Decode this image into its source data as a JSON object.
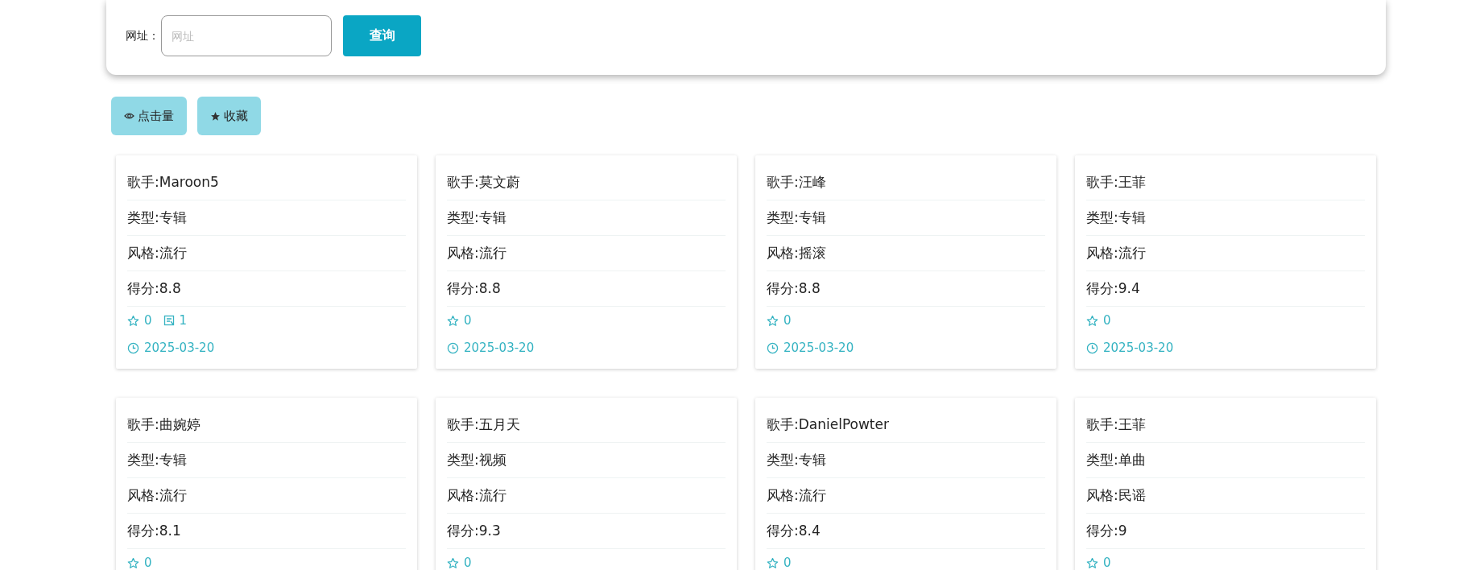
{
  "search": {
    "label": "网址：",
    "placeholder": "网址",
    "button": "查询"
  },
  "sort_buttons": [
    {
      "kind": "eye",
      "label": "点击量"
    },
    {
      "kind": "star",
      "label": "收藏"
    }
  ],
  "cards": [
    {
      "fields": [
        "歌手:Maroon5",
        "类型:专辑",
        "风格:流行",
        "得分:8.8"
      ],
      "favorites": "0",
      "comments": "1",
      "date": "2025-03-20"
    },
    {
      "fields": [
        "歌手:莫文蔚",
        "类型:专辑",
        "风格:流行",
        "得分:8.8"
      ],
      "favorites": "0",
      "date": "2025-03-20"
    },
    {
      "fields": [
        "歌手:汪峰",
        "类型:专辑",
        "风格:摇滚",
        "得分:8.8"
      ],
      "favorites": "0",
      "date": "2025-03-20"
    },
    {
      "fields": [
        "歌手:王菲",
        "类型:专辑",
        "风格:流行",
        "得分:9.4"
      ],
      "favorites": "0",
      "date": "2025-03-20"
    },
    {
      "fields": [
        "歌手:曲婉婷",
        "类型:专辑",
        "风格:流行",
        "得分:8.1"
      ],
      "favorites": "0"
    },
    {
      "fields": [
        "歌手:五月天",
        "类型:视频",
        "风格:流行",
        "得分:9.3"
      ],
      "favorites": "0"
    },
    {
      "fields": [
        "歌手:DanielPowter",
        "类型:专辑",
        "风格:流行",
        "得分:8.4"
      ],
      "favorites": "0"
    },
    {
      "fields": [
        "歌手:王菲",
        "类型:单曲",
        "风格:民谣",
        "得分:9"
      ],
      "favorites": "0"
    }
  ]
}
